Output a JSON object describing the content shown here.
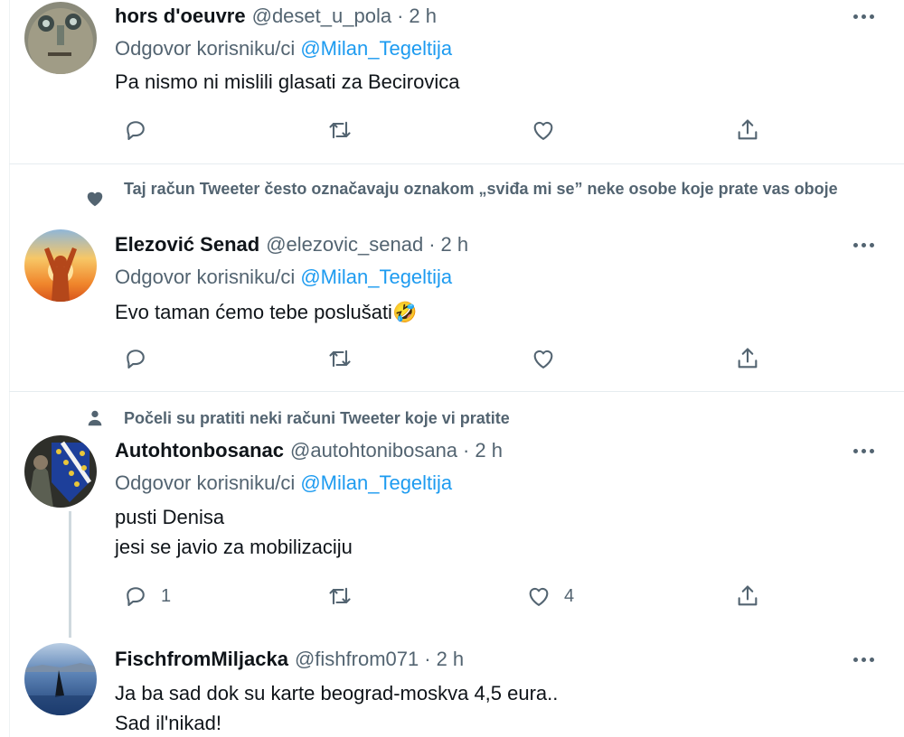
{
  "tweets": [
    {
      "name": "hors d'oeuvre",
      "handle": "@deset_u_pola",
      "separator": "·",
      "time": "2 h",
      "reply_prefix": "Odgovor korisniku/ci",
      "reply_mention": "@Milan_Tegeltija",
      "text": [
        "Pa nismo ni mislili glasati za Becirovica"
      ],
      "reply_count": "",
      "like_count": ""
    },
    {
      "social_context": "Taj račun Tweeter često označavaju oznakom „sviđa mi se” neke osobe koje prate vas oboje",
      "social_icon": "heart-icon",
      "name": "Elezović Senad",
      "handle": "@elezovic_senad",
      "separator": "·",
      "time": "2 h",
      "reply_prefix": "Odgovor korisniku/ci",
      "reply_mention": "@Milan_Tegeltija",
      "text": [
        "Evo taman ćemo tebe poslušati🤣"
      ],
      "reply_count": "",
      "like_count": ""
    },
    {
      "social_context": "Počeli su pratiti neki računi Tweeter koje vi pratite",
      "social_icon": "person-icon",
      "name": "Autohtonbosanac",
      "handle": "@autohtonibosana",
      "separator": "·",
      "time": "2 h",
      "reply_prefix": "Odgovor korisniku/ci",
      "reply_mention": "@Milan_Tegeltija",
      "text": [
        "pusti Denisa",
        "jesi se javio za mobilizaciju"
      ],
      "reply_count": "1",
      "like_count": "4"
    },
    {
      "name": "FischfromMiljacka",
      "handle": "@fishfrom071",
      "separator": "·",
      "time": "2 h",
      "text": [
        "Ja ba sad dok su karte beograd-moskva 4,5 eura..",
        "Sad il'nikad!"
      ]
    }
  ],
  "colors": {
    "text_primary": "#0f1419",
    "text_secondary": "#536471",
    "accent": "#1d9bf0",
    "divider": "#e6ecf0"
  }
}
